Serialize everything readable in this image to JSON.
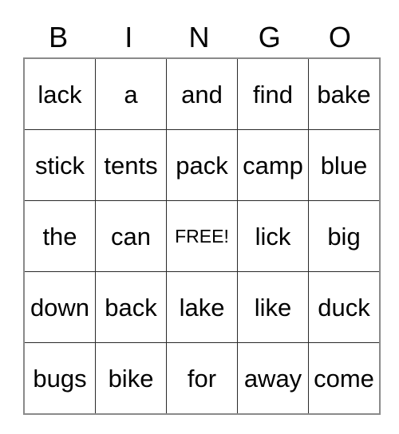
{
  "card": {
    "title": "BINGO",
    "free_space_label": "FREE!",
    "colors": {
      "outer_border": "#8a8a8a",
      "cell_border": "#2a2a2a",
      "text": "#000000",
      "background": "#ffffff"
    },
    "header": {
      "letters": [
        "B",
        "I",
        "N",
        "G",
        "O"
      ]
    },
    "grid": {
      "rows": 5,
      "columns": 5,
      "cells": [
        [
          {
            "text": "lack",
            "free": false
          },
          {
            "text": "a",
            "free": false
          },
          {
            "text": "and",
            "free": false
          },
          {
            "text": "find",
            "free": false
          },
          {
            "text": "bake",
            "free": false
          }
        ],
        [
          {
            "text": "stick",
            "free": false
          },
          {
            "text": "tents",
            "free": false
          },
          {
            "text": "pack",
            "free": false
          },
          {
            "text": "camp",
            "free": false
          },
          {
            "text": "blue",
            "free": false
          }
        ],
        [
          {
            "text": "the",
            "free": false
          },
          {
            "text": "can",
            "free": false
          },
          {
            "text": "FREE!",
            "free": true
          },
          {
            "text": "lick",
            "free": false
          },
          {
            "text": "big",
            "free": false
          }
        ],
        [
          {
            "text": "down",
            "free": false
          },
          {
            "text": "back",
            "free": false
          },
          {
            "text": "lake",
            "free": false
          },
          {
            "text": "like",
            "free": false
          },
          {
            "text": "duck",
            "free": false
          }
        ],
        [
          {
            "text": "bugs",
            "free": false
          },
          {
            "text": "bike",
            "free": false
          },
          {
            "text": "for",
            "free": false
          },
          {
            "text": "away",
            "free": false
          },
          {
            "text": "come",
            "free": false
          }
        ]
      ]
    }
  }
}
